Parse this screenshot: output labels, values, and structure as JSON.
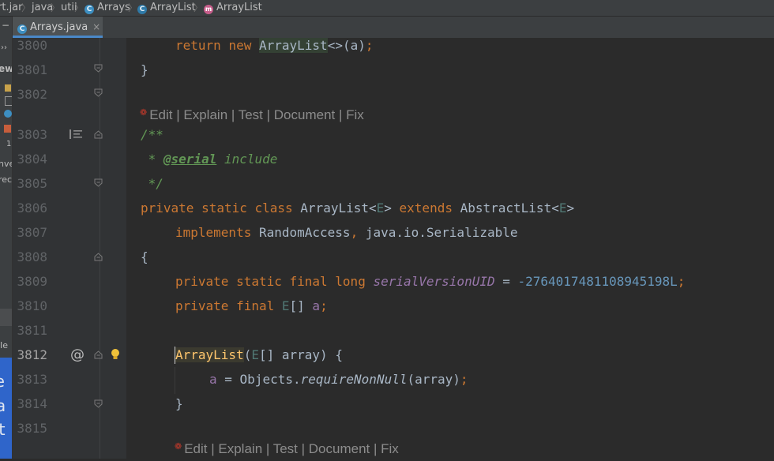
{
  "breadcrumb": {
    "items": [
      {
        "label": "rt.jar"
      },
      {
        "label": "java"
      },
      {
        "label": "util"
      },
      {
        "label": "Arrays",
        "icon": "class-icon"
      },
      {
        "label": "ArrayList",
        "icon": "inner-class-icon"
      },
      {
        "label": "ArrayList",
        "icon": "method-icon"
      }
    ],
    "separator": "〉"
  },
  "tab": {
    "label": "Arrays.java",
    "close": "×"
  },
  "left_panel": {
    "fragments": [
      "−",
      "››",
      "ew",
      "1",
      "nve",
      "rec",
      "Ιe",
      "a",
      "t"
    ]
  },
  "editor": {
    "line_numbers": [
      "3800",
      "3801",
      "3802",
      "3803",
      "3804",
      "3805",
      "3806",
      "3807",
      "3808",
      "3809",
      "3810",
      "3811",
      "3812",
      "3813",
      "3814",
      "3815"
    ],
    "current_line": "3812",
    "lines": {
      "l3800": {
        "kw1": "return",
        "kw2": "new",
        "cls": "ArrayList",
        "rest": "<>(a)",
        "semi": ";"
      },
      "l3801": {
        "text": "}"
      },
      "l3803": {
        "text": "/**"
      },
      "l3804": {
        "star": " * ",
        "tag": "@serial",
        "word": " include"
      },
      "l3805": {
        "text": " */"
      },
      "l3806": {
        "kw": "private static class",
        "name": " ArrayList<",
        "tparam": "E",
        "gt": "> ",
        "kw2": "extends",
        "super": " AbstractList<",
        "tparam2": "E",
        "end": ">"
      },
      "l3807": {
        "kw": "implements",
        "rest1": " RandomAccess",
        "comma": ",",
        "rest2": " java.io.Serializable"
      },
      "l3808": {
        "text": "{"
      },
      "l3809": {
        "kw": "private static final long",
        "field": "serialVersionUID",
        "eq": " = ",
        "num": "-2764017481108945198L",
        "semi": ";"
      },
      "l3810": {
        "kw": "private final",
        "type1": " ",
        "tparam": "E",
        "arr": "[] ",
        "field": "a",
        "semi": ";"
      },
      "l3812": {
        "name": "ArrayList",
        "open": "(",
        "tparam": "E",
        "rest": "[] array) {"
      },
      "l3813": {
        "field": "a",
        "mid": " = Objects.",
        "meth": "requireNonNull",
        "args": "(array)",
        "semi": ";"
      },
      "l3814": {
        "text": "}"
      }
    },
    "inlay_hints": {
      "first": {
        "edit": "Edit",
        "explain": "Explain",
        "test": "Test",
        "document": "Document",
        "fix": "Fix",
        "sep": " | "
      },
      "second": {
        "edit": "Edit",
        "explain": "Explain",
        "test": "Test",
        "document": "Document",
        "fix": "Fix",
        "sep": " | "
      }
    },
    "gutter": {
      "override_marker": "@"
    },
    "colors": {
      "background": "#2b2b2b",
      "keyword": "#cc7832",
      "field": "#9876aa",
      "number": "#6897bb",
      "doc_comment": "#629755",
      "text": "#a9b7c6"
    }
  }
}
